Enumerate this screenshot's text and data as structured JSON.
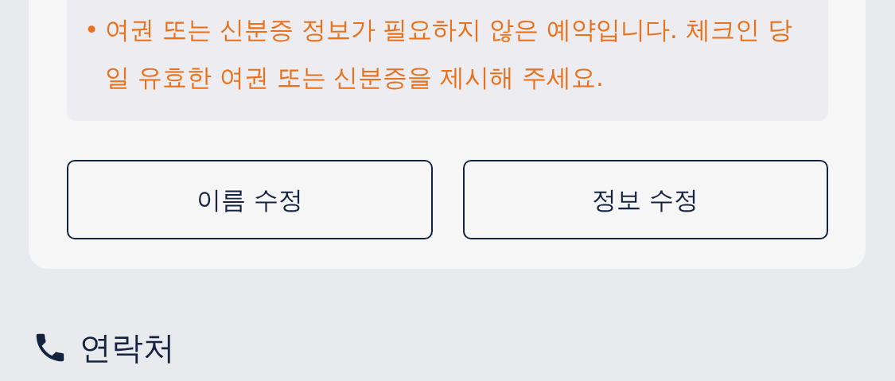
{
  "notice": {
    "bullet": "•",
    "text": "여권 또는 신분증 정보가 필요하지 않은 예약입니다. 체크인 당일 유효한 여권 또는 신분증을 제시해 주세요."
  },
  "buttons": [
    {
      "label": "이름 수정"
    },
    {
      "label": "정보 수정"
    }
  ],
  "section": {
    "title": "연락처"
  }
}
